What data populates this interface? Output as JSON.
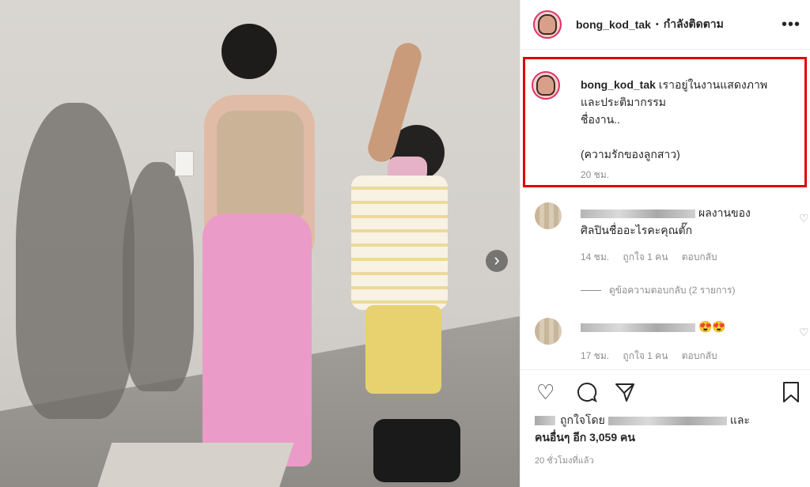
{
  "post": {
    "username": "bong_kod_tak",
    "follow_status": "กำลังติดตาม",
    "more_icon": "more-icon",
    "next_icon": "chevron-right-icon"
  },
  "caption": {
    "username": "bong_kod_tak",
    "line1": "เราอยู่ในงานแสดงภาพ",
    "line2": "และประติมากรรม",
    "line3": "ชื่องาน..",
    "line4": "(ความรักของลูกสาว)",
    "time": "20 ชม."
  },
  "comments": [
    {
      "text_line1": "ผลงานของ",
      "text_line2": "ศิลปินชื่ออะไรคะคุณตั๊ก",
      "time": "14 ชม.",
      "likes": "ถูกใจ 1 คน",
      "reply": "ตอบกลับ"
    },
    {
      "text_line1": "😍😍",
      "time": "17 ชม.",
      "likes": "ถูกใจ 1 คน",
      "reply": "ตอบกลับ"
    }
  ],
  "view_replies": "ดูข้อความตอบกลับ (2 รายการ)",
  "likes": {
    "prefix": "ถูกใจโดย",
    "suffix": "และ",
    "others": "คนอื่นๆ อีก 3,059 คน"
  },
  "time_ago": "20 ชั่วโมงที่แล้ว",
  "colors": {
    "highlight_border": "#e00000",
    "meta_text": "#8e8e8e"
  }
}
